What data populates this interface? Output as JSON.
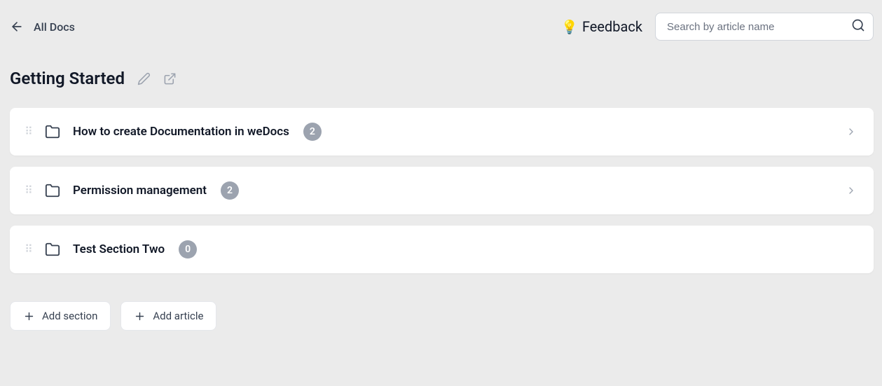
{
  "header": {
    "breadcrumb": "All Docs",
    "feedback_label": "Feedback",
    "search_placeholder": "Search by article name"
  },
  "page": {
    "title": "Getting Started"
  },
  "sections": [
    {
      "title": "How to create Documentation in weDocs",
      "count": "2",
      "has_chevron": true
    },
    {
      "title": "Permission management",
      "count": "2",
      "has_chevron": true
    },
    {
      "title": "Test Section Two",
      "count": "0",
      "has_chevron": false
    }
  ],
  "actions": {
    "add_section": "Add section",
    "add_article": "Add article"
  }
}
